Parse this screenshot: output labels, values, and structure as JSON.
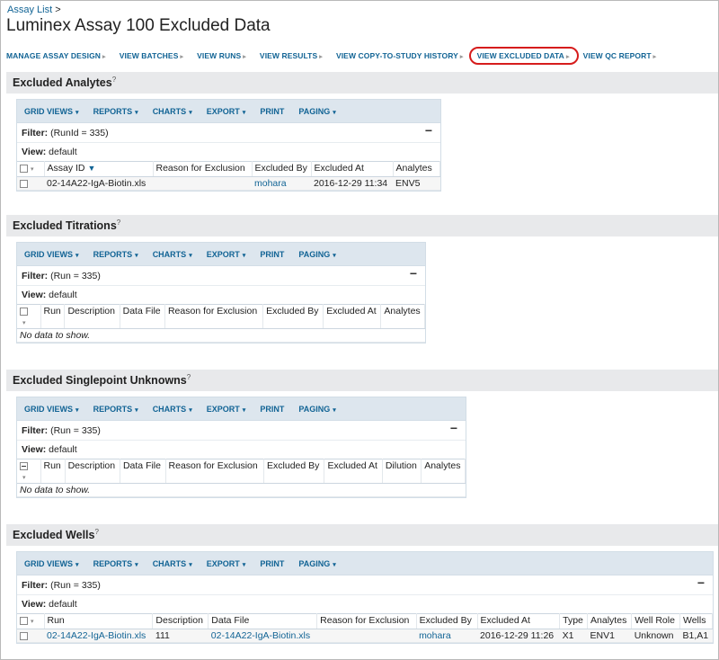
{
  "breadcrumb": {
    "label": "Assay List",
    "sep": ">"
  },
  "page_title": "Luminex Assay 100 Excluded Data",
  "nav": {
    "items": [
      {
        "label": "MANAGE ASSAY DESIGN"
      },
      {
        "label": "VIEW BATCHES"
      },
      {
        "label": "VIEW RUNS"
      },
      {
        "label": "VIEW RESULTS"
      },
      {
        "label": "VIEW COPY-TO-STUDY HISTORY"
      },
      {
        "label": "VIEW EXCLUDED DATA",
        "active": true
      },
      {
        "label": "VIEW QC REPORT"
      }
    ],
    "arrow": "▸"
  },
  "toolbar": {
    "grid_views": "GRID VIEWS",
    "reports": "REPORTS",
    "charts": "CHARTS",
    "export": "EXPORT",
    "print": "PRINT",
    "paging": "PAGING",
    "caret": "▾"
  },
  "labels": {
    "filter": "Filter:",
    "view": "View:",
    "view_value": "default",
    "no_data": "No data to show.",
    "help_mark": "?"
  },
  "analytes": {
    "title": "Excluded Analytes",
    "filter": "(RunId = 335)",
    "columns": [
      "Assay ID",
      "Reason for Exclusion",
      "Excluded By",
      "Excluded At",
      "Analytes"
    ],
    "rows": [
      {
        "assay_id": "02-14A22-IgA-Biotin.xls",
        "reason": "",
        "excluded_by": "mohara",
        "excluded_at": "2016-12-29 11:34",
        "analytes": "ENV5"
      }
    ]
  },
  "titrations": {
    "title": "Excluded Titrations",
    "filter": "(Run = 335)",
    "columns": [
      "Run",
      "Description",
      "Data File",
      "Reason for Exclusion",
      "Excluded By",
      "Excluded At",
      "Analytes"
    ]
  },
  "singlepoint": {
    "title": "Excluded Singlepoint Unknowns",
    "filter": "(Run = 335)",
    "columns": [
      "Run",
      "Description",
      "Data File",
      "Reason for Exclusion",
      "Excluded By",
      "Excluded At",
      "Dilution",
      "Analytes"
    ]
  },
  "wells": {
    "title": "Excluded Wells",
    "filter": "(Run = 335)",
    "columns": [
      "Run",
      "Description",
      "Data File",
      "Reason for Exclusion",
      "Excluded By",
      "Excluded At",
      "Type",
      "Analytes",
      "Well Role",
      "Wells"
    ],
    "rows": [
      {
        "run": "02-14A22-IgA-Biotin.xls",
        "description": "111",
        "data_file": "02-14A22-IgA-Biotin.xls",
        "reason": "",
        "excluded_by": "mohara",
        "excluded_at": "2016-12-29 11:26",
        "type": "X1",
        "analytes": "ENV1",
        "well_role": "Unknown",
        "wells": "B1,A1"
      }
    ]
  }
}
